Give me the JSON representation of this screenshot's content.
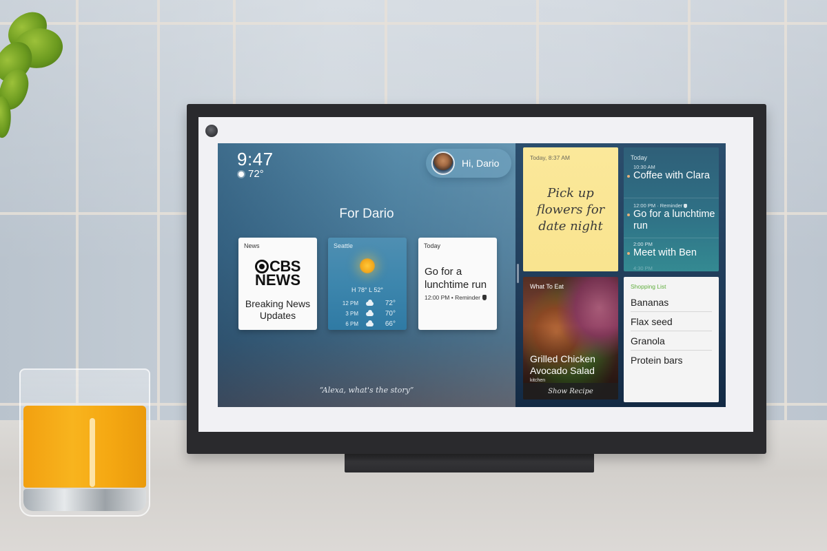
{
  "status": {
    "time": "9:47",
    "temperature": "72°",
    "weather_icon": "sun-icon"
  },
  "greeting": {
    "text": "Hi, Dario",
    "avatar_icon": "user-avatar"
  },
  "home": {
    "title": "For Dario",
    "prompt": "“Alexa, what's the story”"
  },
  "cards": {
    "news": {
      "label": "News",
      "brand_line1": "CBS",
      "brand_line2": "NEWS",
      "headline": "Breaking News Updates"
    },
    "weather": {
      "label": "Seattle",
      "hilo": "H 78° L 52°",
      "forecast": [
        {
          "time": "12 PM",
          "icon": "cloud-icon",
          "temp": "72°"
        },
        {
          "time": "3 PM",
          "icon": "cloud-icon",
          "temp": "70°"
        },
        {
          "time": "6 PM",
          "icon": "cloud-icon",
          "temp": "66°"
        }
      ]
    },
    "today": {
      "label": "Today",
      "title": "Go for a lunchtime run",
      "subtitle": "12:00 PM • Reminder",
      "icon": "hand-icon"
    }
  },
  "sticky_note": {
    "timestamp": "Today, 8:37 AM",
    "text": "Pick up flowers for date night"
  },
  "calendar": {
    "label": "Today",
    "events": [
      {
        "time": "10:30 AM",
        "title": "Coffee with Clara"
      },
      {
        "time": "12:00 PM · Reminder",
        "title": "Go for a lunchtime run"
      },
      {
        "time": "2:00 PM",
        "title": "Meet with Ben"
      }
    ],
    "more_time": "4:30 PM"
  },
  "recipe": {
    "label": "What To Eat",
    "title": "Grilled Chicken Avocado Salad",
    "source": "kitchen",
    "action": "Show Recipe"
  },
  "shopping_list": {
    "label": "Shopping List",
    "items": [
      "Bananas",
      "Flax seed",
      "Granola",
      "Protein bars"
    ]
  },
  "colors": {
    "accent_green": "#5fae3c",
    "sticky_yellow": "#fbe89a",
    "screen_blue": "#3f7394"
  }
}
